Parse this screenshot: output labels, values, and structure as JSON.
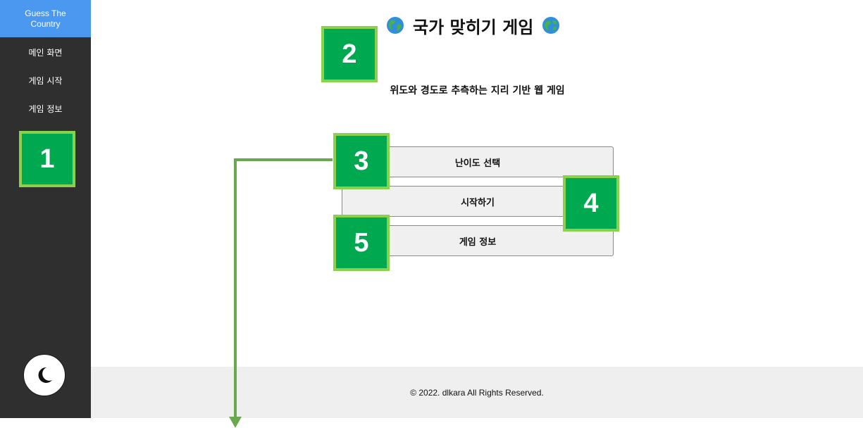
{
  "sidebar": {
    "brand": "Guess The Country",
    "items": [
      {
        "label": "메인 화면"
      },
      {
        "label": "게임 시작"
      },
      {
        "label": "게임 정보"
      }
    ],
    "theme_toggle_icon": "moon-icon"
  },
  "main": {
    "title_icon": "globe-icon",
    "title": "국가 맞히기 게임",
    "subtitle": "위도와 경도로 추측하는 지리 기반 웹 게임",
    "buttons": [
      {
        "label": "난이도 선택"
      },
      {
        "label": "시작하기"
      },
      {
        "label": "게임 정보"
      }
    ]
  },
  "footer": {
    "text": "© 2022. dlkara All Rights Reserved."
  },
  "annotations": {
    "badges": [
      "1",
      "2",
      "3",
      "4",
      "5"
    ],
    "badge_color": "#00a84f",
    "badge_border": "#8ad24e",
    "arrow_color": "#6aa84f"
  }
}
